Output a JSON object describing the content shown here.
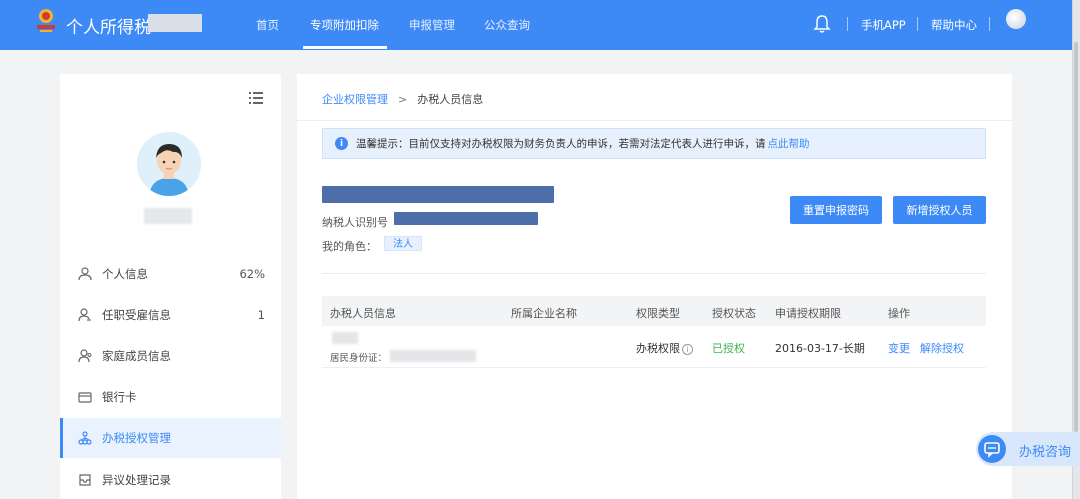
{
  "header": {
    "app_title": "个人所得税",
    "nav": [
      {
        "label": "首页"
      },
      {
        "label": "专项附加扣除"
      },
      {
        "label": "申报管理"
      },
      {
        "label": "公众查询"
      }
    ],
    "mobile_app": "手机APP",
    "help_center": "帮助中心"
  },
  "sidebar": {
    "items": [
      {
        "label": "个人信息",
        "value": "62%"
      },
      {
        "label": "任职受雇信息",
        "value": "1"
      },
      {
        "label": "家庭成员信息",
        "value": ""
      },
      {
        "label": "银行卡",
        "value": ""
      },
      {
        "label": "办税授权管理",
        "value": ""
      },
      {
        "label": "异议处理记录",
        "value": ""
      }
    ]
  },
  "breadcrumb": {
    "parent": "企业权限管理",
    "current": "办税人员信息"
  },
  "notice": {
    "text": "温馨提示：目前仅支持对办税权限为财务负责人的申诉，若需对法定代表人进行申诉，请",
    "link": "点此帮助"
  },
  "company": {
    "tax_id_label": "纳税人识别号",
    "role_label": "我的角色：",
    "role_value": "法人"
  },
  "buttons": {
    "reset_password": "重置申报密码",
    "add_authorized": "新增授权人员"
  },
  "table": {
    "columns": [
      "办税人员信息",
      "所属企业名称",
      "权限类型",
      "授权状态",
      "申请授权期限",
      "操作"
    ],
    "rows": [
      {
        "id_label": "居民身份证：",
        "permission": "办税权限",
        "status": "已授权",
        "period": "2016-03-17-长期",
        "actions": [
          "变更",
          "解除授权"
        ]
      }
    ]
  },
  "consult": {
    "label": "办税咨询"
  },
  "colors": {
    "primary": "#3d8af7",
    "success": "#3fb24a",
    "notice_bg": "#e7f1fd"
  }
}
